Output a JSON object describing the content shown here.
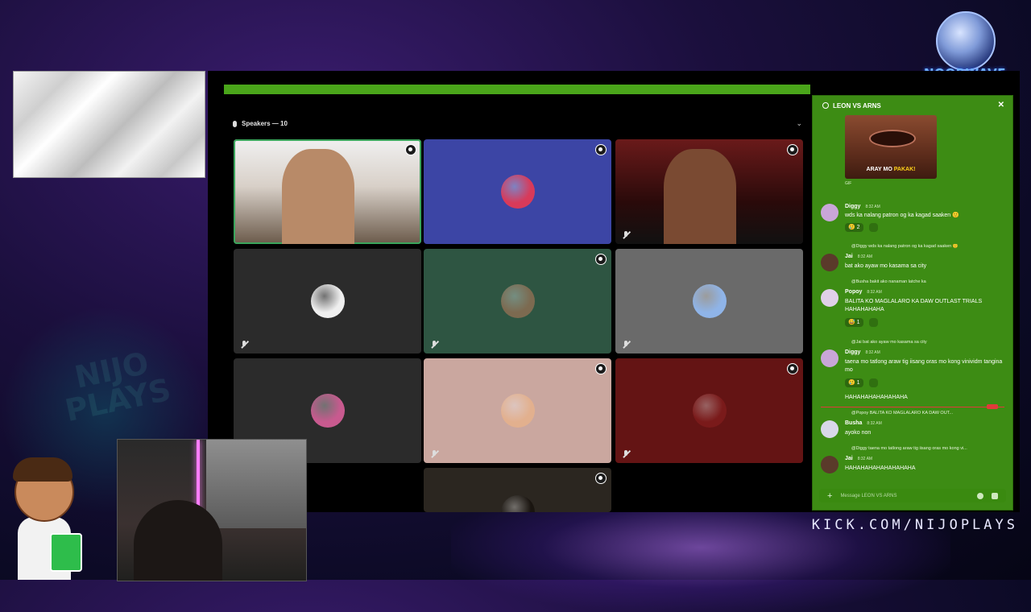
{
  "stream": {
    "channel_url": "KICK.COM/NIJOPLAYS",
    "logo_text": "NOORWAVE"
  },
  "call": {
    "section_header": "Speakers — 10",
    "tiles": [
      {
        "type": "video",
        "bg": "#ffffff",
        "speaking": true,
        "muted": false,
        "gear": true
      },
      {
        "type": "avatar",
        "bg": "#3c45a5",
        "avatar_color": "#d83a5a",
        "muted": false,
        "gear": true
      },
      {
        "type": "video",
        "bg": "#5a1c1c",
        "speaking": false,
        "muted": true,
        "gear": true
      },
      {
        "type": "avatar",
        "bg": "#2b2b2b",
        "avatar_color": "#efefef",
        "muted": true,
        "gear": false
      },
      {
        "type": "avatar",
        "bg": "#2e5542",
        "avatar_color": "#7c6a50",
        "muted": true,
        "gear": true
      },
      {
        "type": "avatar",
        "bg": "#6a6a6a",
        "avatar_color": "#8fb4e8",
        "muted": true,
        "gear": false
      },
      {
        "type": "avatar",
        "bg": "#2b2b2b",
        "avatar_color": "#c85a8f",
        "muted": false,
        "gear": false
      },
      {
        "type": "avatar",
        "bg": "#caa79f",
        "avatar_color": "#e2b08e",
        "muted": true,
        "gear": true
      },
      {
        "type": "avatar",
        "bg": "#641414",
        "avatar_color": "#7a1a1a",
        "muted": true,
        "gear": true
      },
      {
        "type": "avatar",
        "bg": "#2b2620",
        "avatar_color": "#1a1510",
        "muted": false,
        "gear": true
      }
    ]
  },
  "chat": {
    "title": "LEON VS ARNS",
    "gif_caption_prefix": "ARAY MO ",
    "gif_caption_highlight": "PAKAK!",
    "gif_label": "GIF",
    "messages": [
      {
        "author": "Diggy",
        "time": "8:32 AM",
        "text": "wds ka nalang patron og ka kagad saaken 🙂",
        "reaction": "🥲 2",
        "avatar_color": "#c9a6d8"
      },
      {
        "reply": "@Diggy wds ka nalang patron og ka kagad saaken 🙂",
        "author": "Jai",
        "time": "8:32 AM",
        "text": "bat ako ayaw mo kasama sa city",
        "avatar_color": "#5a3a2a"
      },
      {
        "reply": "@Busha bakit ako nanaman latche ka",
        "author": "Popoy",
        "time": "8:32 AM",
        "text": "BALITA KO MAGLALARO KA DAW OUTLAST TRIALS HAHAHAHAHA",
        "reaction": "😅 1",
        "avatar_color": "#e0d0e8"
      },
      {
        "reply": "@Jai bat ako ayaw mo kasama sa city",
        "author": "Diggy",
        "time": "8:32 AM",
        "text": "taena mo tatlong araw tig iisang oras mo kong vinividm tangina mo",
        "reaction": "🥲 1",
        "avatar_color": "#c9a6d8"
      },
      {
        "author": "",
        "time": "",
        "text": "HAHAHAHAHAHAHAHA"
      },
      {
        "reply": "@Popoy BALITA KO MAGLALARO KA DAW OUT...",
        "author": "Busha",
        "time": "8:32 AM",
        "text": "ayoko non",
        "avatar_color": "#d8d8e8"
      },
      {
        "reply": "@Diggy taena mo tatlong araw tig iisang oras mo kong vi...",
        "author": "Jai",
        "time": "8:32 AM",
        "text": "HAHAHAHAHAHAHAHAHA",
        "avatar_color": "#5a3a2a"
      }
    ],
    "input_placeholder": "Message LEON VS ARNS"
  }
}
